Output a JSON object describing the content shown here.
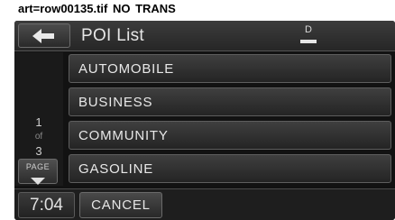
{
  "caption": "art=row00135.tif        NO TRANS",
  "header": {
    "back_icon": "left-arrow-icon",
    "title": "POI List",
    "gps_indicator": {
      "icon": "gps-signal-icon",
      "letter": "D"
    }
  },
  "pager": {
    "current": "1",
    "of_label": "of",
    "total": "3",
    "page_label": "PAGE",
    "page_icon": "triangle-down-icon"
  },
  "list": {
    "items": [
      {
        "label": "AUTOMOBILE"
      },
      {
        "label": "BUSINESS"
      },
      {
        "label": "COMMUNITY"
      },
      {
        "label": "GASOLINE"
      }
    ]
  },
  "footer": {
    "clock": "7:04",
    "cancel_label": "CANCEL"
  },
  "colors": {
    "screen_bg": "#121212",
    "button_border": "#5e5e5e",
    "text": "#e8e8e8"
  }
}
